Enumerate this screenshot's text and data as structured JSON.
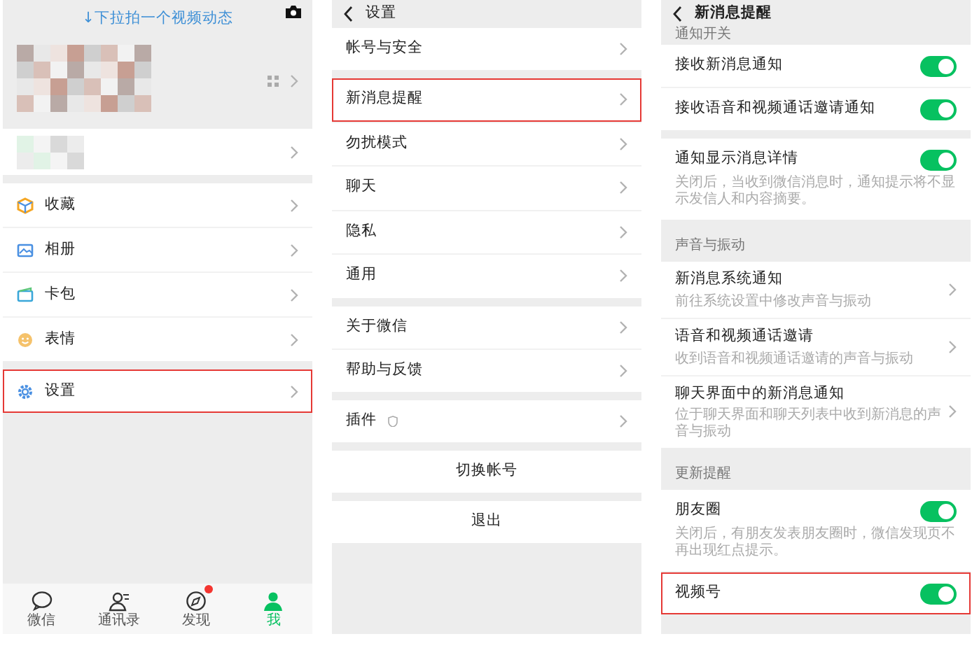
{
  "me_screen": {
    "pull_hint": "↓下拉拍一个视频动态",
    "menu_groups": [
      [
        {
          "label": "收藏",
          "kind": "favorites",
          "highlighted": false
        },
        {
          "label": "相册",
          "kind": "album",
          "highlighted": false
        },
        {
          "label": "卡包",
          "kind": "cards",
          "highlighted": false
        },
        {
          "label": "表情",
          "kind": "stickers",
          "highlighted": false
        }
      ],
      [
        {
          "label": "设置",
          "kind": "settings",
          "highlighted": true
        }
      ]
    ],
    "tabs": [
      {
        "label": "微信",
        "kind": "chats",
        "selected": false,
        "badge": false
      },
      {
        "label": "通讯录",
        "kind": "contacts",
        "selected": false,
        "badge": false
      },
      {
        "label": "发现",
        "kind": "discover",
        "selected": false,
        "badge": true
      },
      {
        "label": "我",
        "kind": "me",
        "selected": true,
        "badge": false
      }
    ]
  },
  "settings_screen": {
    "title": "设置",
    "groups": [
      [
        {
          "label": "帐号与安全",
          "highlighted": false,
          "has_icon": false
        }
      ],
      [
        {
          "label": "新消息提醒",
          "highlighted": true,
          "has_icon": false
        },
        {
          "label": "勿扰模式",
          "highlighted": false,
          "has_icon": false
        },
        {
          "label": "聊天",
          "highlighted": false,
          "has_icon": false
        },
        {
          "label": "隐私",
          "highlighted": false,
          "has_icon": false
        },
        {
          "label": "通用",
          "highlighted": false,
          "has_icon": false
        }
      ],
      [
        {
          "label": "关于微信",
          "highlighted": false,
          "has_icon": false
        },
        {
          "label": "帮助与反馈",
          "highlighted": false,
          "has_icon": false
        }
      ],
      [
        {
          "label": "插件",
          "highlighted": false,
          "has_icon": true
        }
      ]
    ],
    "actions": [
      "切换帐号",
      "退出"
    ]
  },
  "notifications_screen": {
    "title": "新消息提醒",
    "sections": [
      {
        "header": "通知开关",
        "rows": [
          {
            "label": "接收新消息通知",
            "kind": "toggle",
            "on": true,
            "highlighted": false
          },
          {
            "label": "接收语音和视频通话邀请通知",
            "kind": "toggle",
            "on": true,
            "highlighted": false
          }
        ]
      },
      {
        "rows": [
          {
            "label": "通知显示消息详情",
            "kind": "toggle",
            "on": true,
            "highlighted": false,
            "description": "关闭后，当收到微信消息时，通知提示将不显示发信人和内容摘要。"
          }
        ]
      },
      {
        "header": "声音与振动",
        "rows": [
          {
            "label": "新消息系统通知",
            "kind": "link",
            "highlighted": false,
            "description": "前往系统设置中修改声音与振动"
          },
          {
            "label": "语音和视频通话邀请",
            "kind": "link",
            "highlighted": false,
            "description": "收到语音和视频通话邀请的声音与振动"
          },
          {
            "label": "聊天界面中的新消息通知",
            "kind": "link",
            "highlighted": false,
            "description": "位于聊天界面和聊天列表中收到新消息的声音与振动"
          }
        ]
      },
      {
        "header": "更新提醒",
        "rows": [
          {
            "label": "朋友圈",
            "kind": "toggle",
            "on": true,
            "highlighted": false,
            "description": "关闭后，有朋友发表朋友圈时，微信发现页不再出现红点提示。"
          },
          {
            "label": "视频号",
            "kind": "toggle",
            "on": true,
            "highlighted": true
          }
        ]
      }
    ]
  }
}
